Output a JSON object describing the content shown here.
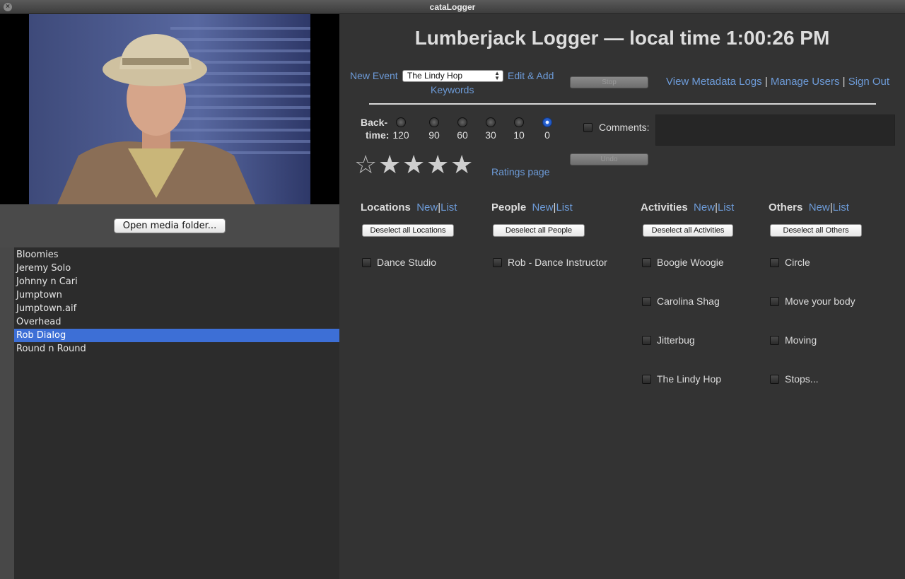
{
  "window": {
    "title": "cataLogger"
  },
  "left": {
    "open_media_label": "Open media folder...",
    "files": [
      "Bloomies",
      "Jeremy Solo",
      "Johnny n Cari",
      "Jumptown",
      "Jumptown.aif",
      "Overhead",
      "Rob Dialog",
      "Round n Round"
    ],
    "selected_file": "Rob Dialog"
  },
  "header": {
    "title": "Lumberjack Logger — local time 1:00:26 PM"
  },
  "toolbar": {
    "new_event": "New Event",
    "event_select": "The Lindy Hop",
    "edit_add": "Edit & Add",
    "keywords": "Keywords",
    "stop": "Stop",
    "view_logs": "View Metadata Logs",
    "manage_users": "Manage Users",
    "sign_out": "Sign Out",
    "separator": "|"
  },
  "backtime": {
    "label_line1": "Back-",
    "label_line2": "time:",
    "options": [
      "120",
      "90",
      "60",
      "30",
      "10",
      "0"
    ],
    "selected": "0"
  },
  "comments": {
    "label": "Comments:",
    "value": ""
  },
  "rating": {
    "value": 4,
    "max": 5,
    "undo": "Undo",
    "ratings_page": "Ratings page"
  },
  "categories": {
    "new": "New",
    "list": "List",
    "sep": "|",
    "locations": {
      "title": "Locations",
      "deselect": "Deselect all Locations",
      "items": [
        "Dance Studio"
      ]
    },
    "people": {
      "title": "People",
      "deselect": "Deselect all People",
      "items": [
        "Rob - Dance Instructor"
      ]
    },
    "activities": {
      "title": "Activities",
      "deselect": "Deselect all Activities",
      "items": [
        "Boogie Woogie",
        "Carolina Shag",
        "Jitterbug",
        "The Lindy Hop"
      ]
    },
    "others": {
      "title": "Others",
      "deselect": "Deselect all Others",
      "items": [
        "Circle",
        "Move your body",
        "Moving",
        "Stops..."
      ]
    }
  },
  "colors": {
    "background": "#333333",
    "link": "#6d9bd8",
    "selection": "#3d6fd6",
    "radio_on": "#2a66d8"
  }
}
